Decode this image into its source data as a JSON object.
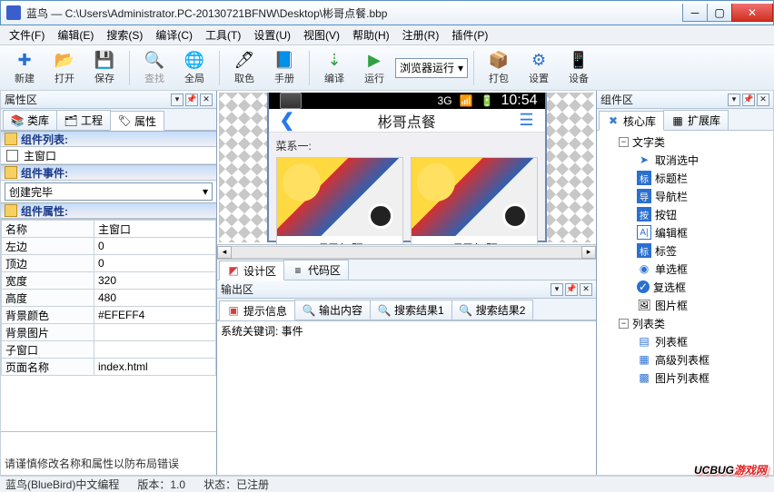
{
  "window": {
    "title": "蓝鸟 — C:\\Users\\Administrator.PC-20130721BFNW\\Desktop\\彬哥点餐.bbp"
  },
  "menu": {
    "file": "文件(F)",
    "edit": "编辑(E)",
    "search": "搜索(S)",
    "compile": "编译(C)",
    "tools": "工具(T)",
    "settings": "设置(U)",
    "view": "视图(V)",
    "help": "帮助(H)",
    "register": "注册(R)",
    "plugin": "插件(P)"
  },
  "toolbar": {
    "new": "新建",
    "open": "打开",
    "save": "保存",
    "find": "查找",
    "global": "全局",
    "pick": "取色",
    "manual": "手册",
    "build": "编译",
    "run": "运行",
    "runmode": "浏览器运行",
    "pack": "打包",
    "setup": "设置",
    "device": "设备"
  },
  "left": {
    "panel_title": "属性区",
    "tabs": {
      "lib": "类库",
      "proj": "工程",
      "prop": "属性"
    },
    "section_list": "组件列表:",
    "main_window": "主窗口",
    "section_events": "组件事件:",
    "event_selected": "创建完毕",
    "section_props": "组件属性:",
    "props": {
      "name_k": "名称",
      "name_v": "主窗口",
      "left_k": "左边",
      "left_v": "0",
      "top_k": "顶边",
      "top_v": "0",
      "width_k": "宽度",
      "width_v": "320",
      "height_k": "高度",
      "height_v": "480",
      "bgcolor_k": "背景颜色",
      "bgcolor_v": "#EFEFF4",
      "bgimg_k": "背景图片",
      "bgimg_v": "",
      "child_k": "子窗口",
      "child_v": "",
      "page_k": "页面名称",
      "page_v": "index.html"
    },
    "hint": "请谨慎修改名称和属性以防布局错误"
  },
  "mid": {
    "phone": {
      "time": "10:54",
      "signal": "3G",
      "nav_title": "彬哥点餐",
      "section": "菜系一:",
      "card1": "项目标题",
      "card2": "项目标题"
    },
    "tabs": {
      "design": "设计区",
      "code": "代码区"
    },
    "output_title": "输出区",
    "output_tabs": {
      "info": "提示信息",
      "content": "输出内容",
      "res1": "搜索结果1",
      "res2": "搜索结果2"
    },
    "output_line": "系统关键词: 事件"
  },
  "right": {
    "panel_title": "组件区",
    "tabs": {
      "core": "核心库",
      "ext": "扩展库"
    },
    "cat_text": "文字类",
    "items_text": {
      "deselect": "取消选中",
      "titlebar": "标题栏",
      "navbar": "导航栏",
      "button": "按钮",
      "editbox": "编辑框",
      "label": "标签",
      "radio": "单选框",
      "checkbox": "复选框",
      "imgbox": "图片框"
    },
    "cat_list": "列表类",
    "items_list": {
      "listbox": "列表框",
      "advlist": "高级列表框",
      "imglist": "图片列表框"
    }
  },
  "status": {
    "left": "蓝鸟(BlueBird)中文编程",
    "version_label": "版本：",
    "version": "1.0",
    "state_label": "状态：",
    "state": "已注册"
  },
  "watermark": {
    "a": "UCBUG",
    "b": "游戏网"
  }
}
